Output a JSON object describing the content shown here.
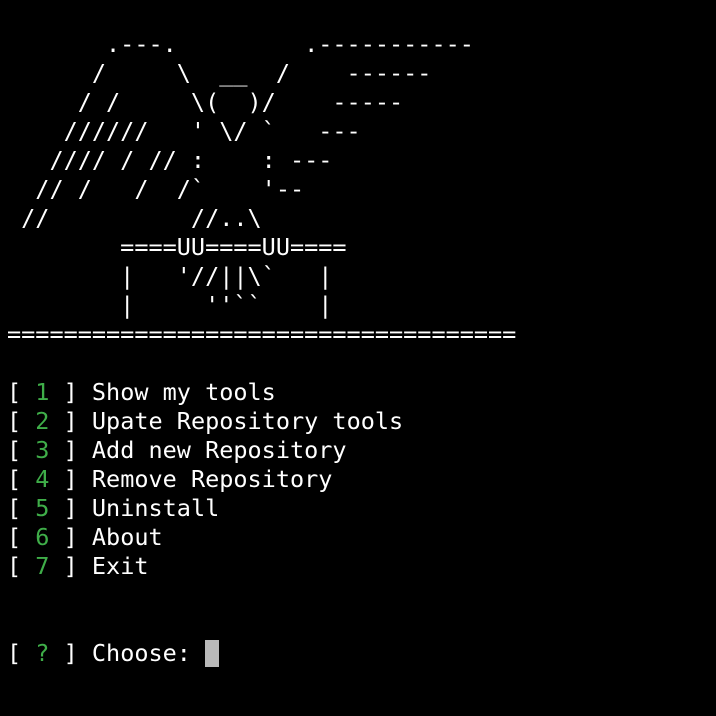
{
  "banner_art": "       .---.         .-----------\n      /     \\  __  /    ------\n     / /     \\(  )/    -----\n    //////   ' \\/ `   ---\n   //// / // :    : ---\n  // /   /  /`    '--\n //          //..\\\n        ====UU====UU====\n        |   '//||\\`   |\n        |     ''``    |",
  "separator": "====================================",
  "menu": [
    {
      "num": "1",
      "label": "Show my tools"
    },
    {
      "num": "2",
      "label": "Upate Repository tools"
    },
    {
      "num": "3",
      "label": "Add new Repository"
    },
    {
      "num": "4",
      "label": "Remove Repository"
    },
    {
      "num": "5",
      "label": "Uninstall"
    },
    {
      "num": "6",
      "label": "About"
    },
    {
      "num": "7",
      "label": "Exit"
    }
  ],
  "prompt": {
    "marker": "?",
    "label": "Choose:"
  },
  "colors": {
    "background": "#000000",
    "text": "#ffffff",
    "accent": "#3fae49",
    "cursor": "#b9b9b9"
  }
}
